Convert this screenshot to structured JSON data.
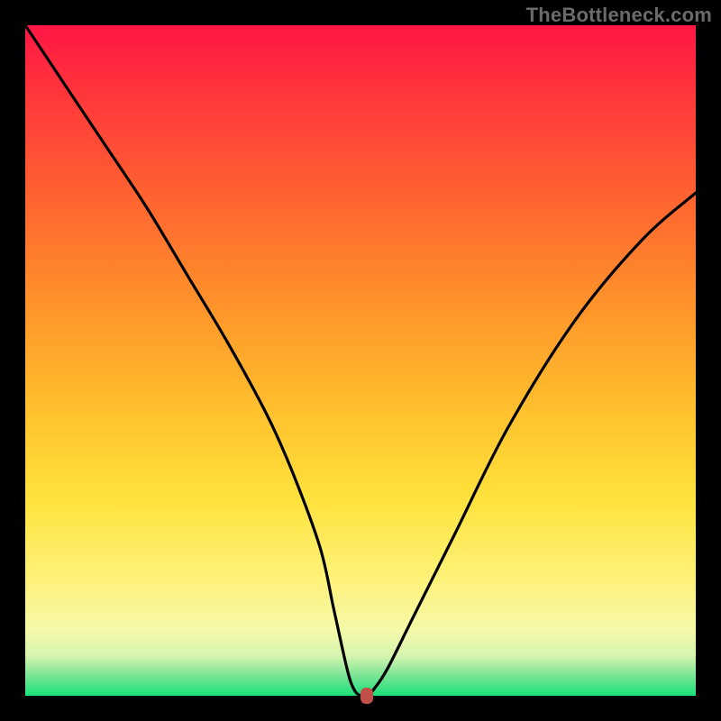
{
  "watermark": "TheBottleneck.com",
  "chart_data": {
    "type": "line",
    "title": "",
    "xlabel": "",
    "ylabel": "",
    "xlim": [
      0,
      100
    ],
    "ylim": [
      0,
      100
    ],
    "series": [
      {
        "name": "curve",
        "x": [
          0,
          6,
          12,
          18,
          24,
          30,
          36,
          40,
          44,
          46,
          48,
          49,
          50,
          51,
          52,
          54,
          58,
          64,
          72,
          82,
          92,
          100
        ],
        "y": [
          100,
          91,
          82,
          73,
          63,
          53,
          42,
          33,
          22,
          13,
          4,
          1,
          0,
          0,
          1,
          4,
          12,
          24,
          40,
          56,
          68,
          75
        ]
      }
    ],
    "marker": {
      "x": 51,
      "y": 0
    },
    "background_gradient": {
      "top": "#ff1744",
      "mid": "#ffd23a",
      "bottom": "#18e07a"
    }
  }
}
